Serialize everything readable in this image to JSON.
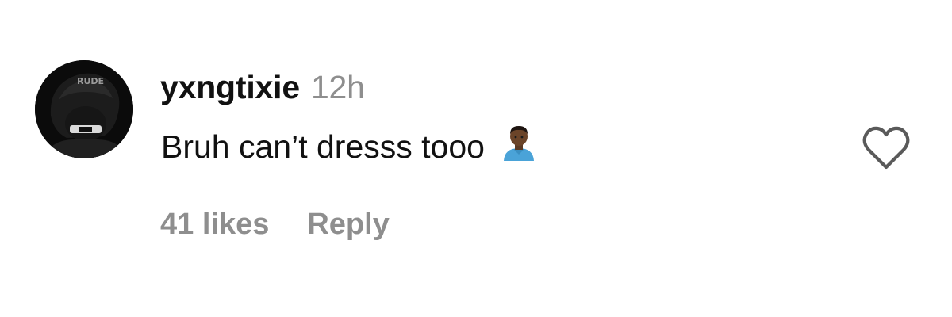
{
  "comment": {
    "username": "yxngtixie",
    "timestamp": "12h",
    "text": "Bruh can’t dresss tooo",
    "emoji": "person-emoji",
    "likes_label": "41 likes",
    "reply_label": "Reply",
    "avatar_text": "RUDE"
  },
  "icons": {
    "like": "heart-outline-icon"
  },
  "colors": {
    "primary_text": "#111111",
    "secondary_text": "#8e8e8e",
    "background": "#ffffff",
    "icon": "#262626"
  }
}
